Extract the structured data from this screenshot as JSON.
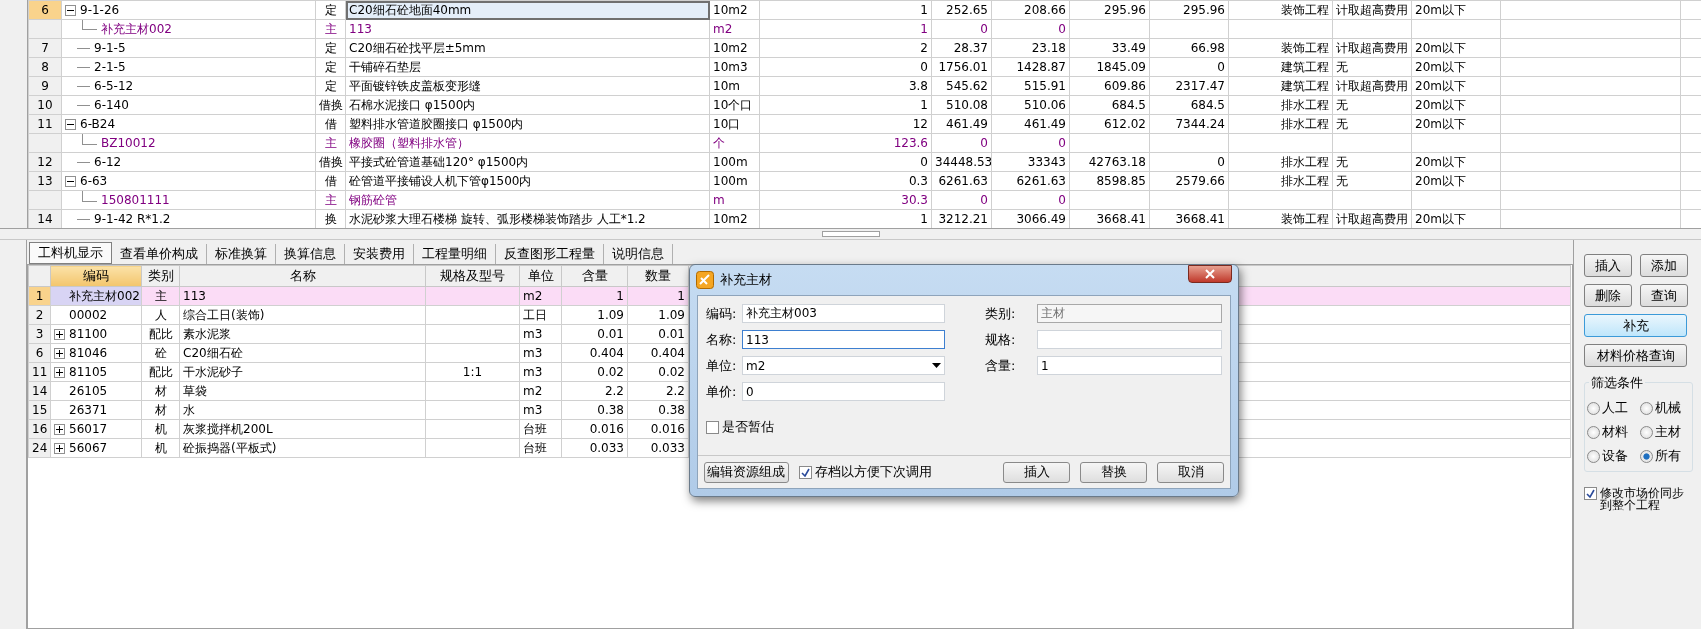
{
  "main_table": {
    "rows": [
      {
        "number": "6",
        "code": "9-1-26",
        "type": "定",
        "name": "C20细石砼地面40mm",
        "unit": "10m2",
        "cells": [
          "1",
          "252.65",
          "208.66",
          "295.96",
          "295.96",
          "装饰工程",
          "计取超高费用",
          "20m以下"
        ],
        "selected": true,
        "expanded": true,
        "children": [
          {
            "code": "补充主材002",
            "type": "主",
            "name": "113",
            "unit": "m2",
            "cells": [
              "1",
              "0",
              "0"
            ]
          }
        ]
      },
      {
        "number": "7",
        "code": "9-1-5",
        "type": "定",
        "name": "C20细石砼找平层±5mm",
        "unit": "10m2",
        "cells": [
          "2",
          "28.37",
          "23.18",
          "33.49",
          "66.98",
          "装饰工程",
          "计取超高费用",
          "20m以下"
        ],
        "selected": false
      },
      {
        "number": "8",
        "code": "2-1-5",
        "type": "定",
        "name": "干铺碎石垫层",
        "unit": "10m3",
        "cells": [
          "0",
          "1756.01",
          "1428.87",
          "1845.09",
          "0",
          "建筑工程",
          "无",
          "20m以下"
        ],
        "selected": false
      },
      {
        "number": "9",
        "code": "6-5-12",
        "type": "定",
        "name": "平面镀锌铁皮盖板变形缝",
        "unit": "10m",
        "cells": [
          "3.8",
          "545.62",
          "515.91",
          "609.86",
          "2317.47",
          "建筑工程",
          "计取超高费用",
          "20m以下"
        ],
        "selected": false
      },
      {
        "number": "10",
        "code": "6-140",
        "type": "借换",
        "name": "石棉水泥接口 φ1500内",
        "unit": "10个口",
        "cells": [
          "1",
          "510.08",
          "510.06",
          "684.5",
          "684.5",
          "排水工程",
          "无",
          "20m以下"
        ],
        "selected": false
      },
      {
        "number": "11",
        "code": "6-B24",
        "type": "借",
        "name": "塑料排水管道胶圈接口 φ1500内",
        "unit": "10口",
        "cells": [
          "12",
          "461.49",
          "461.49",
          "612.02",
          "7344.24",
          "排水工程",
          "无",
          "20m以下"
        ],
        "selected": false,
        "expanded": true,
        "children": [
          {
            "code": "BZ10012",
            "type": "主",
            "name": "橡胶圈（塑料排水管）",
            "unit": "个",
            "cells": [
              "123.6",
              "0",
              "0"
            ]
          }
        ]
      },
      {
        "number": "12",
        "code": "6-12",
        "type": "借换",
        "name": "平接式砼管道基础120°  φ1500内",
        "unit": "100m",
        "cells": [
          "0",
          "34448.53",
          "33343",
          "42763.18",
          "0",
          "排水工程",
          "无",
          "20m以下"
        ],
        "selected": false
      },
      {
        "number": "13",
        "code": "6-63",
        "type": "借",
        "name": "砼管道平接铺设人机下管φ1500内",
        "unit": "100m",
        "cells": [
          "0.3",
          "6261.63",
          "6261.63",
          "8598.85",
          "2579.66",
          "排水工程",
          "无",
          "20m以下"
        ],
        "selected": false,
        "expanded": true,
        "children": [
          {
            "code": "150801111",
            "type": "主",
            "name": "钢筋砼管",
            "unit": "m",
            "cells": [
              "30.3",
              "0",
              "0"
            ]
          }
        ]
      },
      {
        "number": "14",
        "code": "9-1-42 R*1.2",
        "type": "换",
        "name": "水泥砂浆大理石楼梯  旋转、弧形楼梯装饰踏步 人工*1.2",
        "unit": "10m2",
        "cells": [
          "1",
          "3212.21",
          "3066.49",
          "3668.41",
          "3668.41",
          "装饰工程",
          "计取超高费用",
          "20m以下"
        ],
        "selected": false
      }
    ]
  },
  "tabs": [
    {
      "label": "工料机显示",
      "selected": true
    },
    {
      "label": "查看单价构成",
      "selected": false
    },
    {
      "label": "标准换算",
      "selected": false
    },
    {
      "label": "换算信息",
      "selected": false
    },
    {
      "label": "安装费用",
      "selected": false
    },
    {
      "label": "工程量明细",
      "selected": false
    },
    {
      "label": "反查图形工程量",
      "selected": false
    },
    {
      "label": "说明信息",
      "selected": false
    }
  ],
  "resource_table": {
    "columns": [
      "编码",
      "类别",
      "名称",
      "规格及型号",
      "单位",
      "含量",
      "数量"
    ],
    "rows": [
      {
        "number": "1",
        "kind": "single",
        "code": "补充主材002",
        "type": "主",
        "name": "113",
        "spec": "",
        "unit": "m2",
        "content": "1",
        "quantity": "1",
        "selected": true
      },
      {
        "number": "2",
        "kind": "single",
        "code": "00002",
        "type": "人",
        "name": "综合工日(装饰)",
        "spec": "",
        "unit": "工日",
        "content": "1.09",
        "quantity": "1.09",
        "selected": false
      },
      {
        "number": "3",
        "kind": "composite",
        "code": "81100",
        "type": "配比",
        "name": "素水泥浆",
        "spec": "",
        "unit": "m3",
        "content": "0.01",
        "quantity": "0.01",
        "selected": false
      },
      {
        "number": "6",
        "kind": "composite",
        "code": "81046",
        "type": "砼",
        "name": "C20细石砼",
        "spec": "",
        "unit": "m3",
        "content": "0.404",
        "quantity": "0.404",
        "selected": false
      },
      {
        "number": "11",
        "kind": "composite",
        "code": "81105",
        "type": "配比",
        "name": "干水泥砂子",
        "spec": "1:1",
        "unit": "m3",
        "content": "0.02",
        "quantity": "0.02",
        "selected": false
      },
      {
        "number": "14",
        "kind": "single",
        "code": "26105",
        "type": "材",
        "name": "草袋",
        "spec": "",
        "unit": "m2",
        "content": "2.2",
        "quantity": "2.2",
        "selected": false
      },
      {
        "number": "15",
        "kind": "single",
        "code": "26371",
        "type": "材",
        "name": "水",
        "spec": "",
        "unit": "m3",
        "content": "0.38",
        "quantity": "0.38",
        "selected": false
      },
      {
        "number": "16",
        "kind": "composite",
        "code": "56017",
        "type": "机",
        "name": "灰浆搅拌机200L",
        "spec": "",
        "unit": "台班",
        "content": "0.016",
        "quantity": "0.016",
        "selected": false
      },
      {
        "number": "24",
        "kind": "composite",
        "code": "56067",
        "type": "机",
        "name": "砼振捣器(平板式)",
        "spec": "",
        "unit": "台班",
        "content": "0.033",
        "quantity": "0.033",
        "selected": false
      }
    ]
  },
  "dialog": {
    "title": "补充主材",
    "left_fields": [
      {
        "label": "编码:",
        "value": "补充主材003",
        "kind": "text",
        "focused": false
      },
      {
        "label": "名称:",
        "value": "113",
        "kind": "text",
        "focused": true
      },
      {
        "label": "单位:",
        "value": "m2",
        "kind": "select",
        "focused": false
      },
      {
        "label": "单价:",
        "value": "0",
        "kind": "text",
        "focused": false
      }
    ],
    "right_fields": [
      {
        "label": "类别:",
        "value": "主材",
        "kind": "text",
        "disabled": true
      },
      {
        "label": "规格:",
        "kind": "text",
        "disabled": false
      },
      {
        "label": "含量:",
        "value": "1",
        "kind": "text",
        "disabled": false
      }
    ],
    "estimate_checkbox": {
      "label": "是否暂估",
      "checked": false
    },
    "edit_button": "编辑资源组成",
    "save_checkbox": {
      "label": "存档以方便下次调用",
      "checked": true
    },
    "buttons": [
      "插入",
      "替换",
      "取消"
    ]
  },
  "right_panel": {
    "buttons": [
      {
        "label": "插入",
        "kind": "half",
        "selected": false
      },
      {
        "label": "添加",
        "kind": "half",
        "selected": false
      },
      {
        "label": "删除",
        "kind": "half",
        "selected": false
      },
      {
        "label": "查询",
        "kind": "half",
        "selected": false
      },
      {
        "label": "补充",
        "kind": "full",
        "selected": true
      },
      {
        "label": "材料价格查询",
        "kind": "full",
        "selected": false
      }
    ],
    "filter": {
      "title": "筛选条件",
      "options": [
        {
          "label": "人工",
          "selected": false
        },
        {
          "label": "机械",
          "selected": false
        },
        {
          "label": "材料",
          "selected": false
        },
        {
          "label": "主材",
          "selected": false
        },
        {
          "label": "设备",
          "selected": false
        },
        {
          "label": "所有",
          "selected": true
        }
      ]
    },
    "sync_checkbox": {
      "label": "修改市场价同步到整个工程",
      "checked": true
    }
  }
}
